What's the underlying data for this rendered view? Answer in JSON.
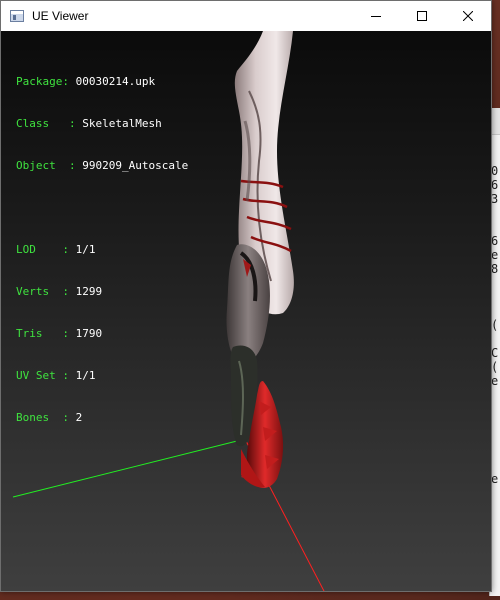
{
  "window": {
    "title": "UE Viewer",
    "buttons": {
      "minimize": "minimize",
      "maximize": "maximize",
      "close": "close"
    }
  },
  "info": {
    "package_label": "Package: ",
    "package_value": "00030214.upk",
    "class_label": "Class   : ",
    "class_value": "SkeletalMesh",
    "object_label": "Object  : ",
    "object_value": "990209_Autoscale",
    "lod_label": "LOD    : ",
    "lod_value": "1/1",
    "verts_label": "Verts  : ",
    "verts_value": "1299",
    "tris_label": "Tris   : ",
    "tris_value": "1790",
    "uvset_label": "UV Set : ",
    "uvset_value": "1/1",
    "bones_label": "Bones  : ",
    "bones_value": "2"
  },
  "background_app_chars": [
    "0",
    "6",
    "3",
    "6",
    "e",
    "8",
    "(",
    "C",
    "(",
    "e",
    "e"
  ],
  "colors": {
    "label_green": "#3fe33f",
    "value_white": "#ffffff",
    "axis_x_red": "#ff2020",
    "axis_y_green": "#22ee22"
  },
  "icons": {
    "app": "app-window-icon",
    "minimize": "minimize-icon",
    "maximize": "maximize-icon",
    "close": "close-icon"
  }
}
